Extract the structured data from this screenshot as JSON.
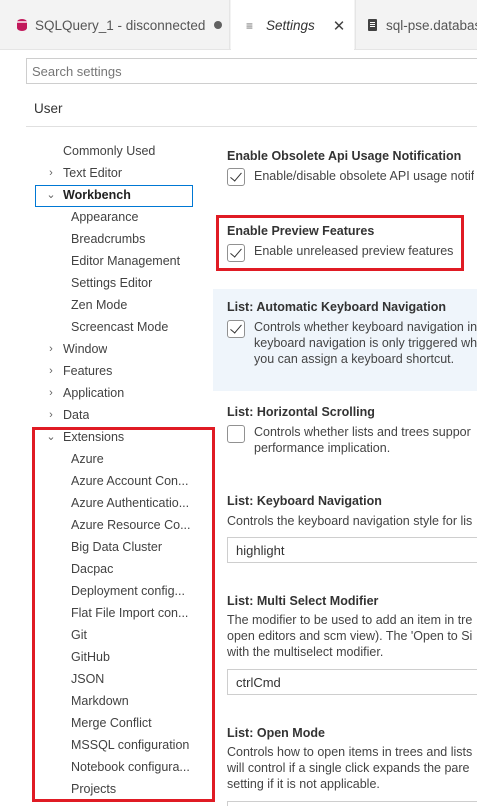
{
  "tabs": [
    {
      "label": "SQLQuery_1 - disconnected",
      "icon": "database-icon"
    },
    {
      "label": "Settings",
      "icon": "settings-icon",
      "close": "✕"
    },
    {
      "label": "sql-pse.databas",
      "icon": "file-icon"
    }
  ],
  "search": {
    "placeholder": "Search settings"
  },
  "scope": {
    "user": "User"
  },
  "toc": {
    "commonly_used": "Commonly Used",
    "text_editor": "Text Editor",
    "workbench": "Workbench",
    "appearance": "Appearance",
    "breadcrumbs": "Breadcrumbs",
    "editor_management": "Editor Management",
    "settings_editor": "Settings Editor",
    "zen_mode": "Zen Mode",
    "screencast_mode": "Screencast Mode",
    "window": "Window",
    "features": "Features",
    "application": "Application",
    "data": "Data",
    "extensions": "Extensions",
    "ext_items": [
      "Azure",
      "Azure Account Con...",
      "Azure Authenticatio...",
      "Azure Resource Co...",
      "Big Data Cluster",
      "Dacpac",
      "Deployment config...",
      "Flat File Import con...",
      "Git",
      "GitHub",
      "JSON",
      "Markdown",
      "Merge Conflict",
      "MSSQL configuration",
      "Notebook configura...",
      "Projects"
    ]
  },
  "settings": {
    "obsolete": {
      "title": "Enable Obsolete Api Usage Notification",
      "desc": "Enable/disable obsolete API usage notif"
    },
    "preview": {
      "title": "Enable Preview Features",
      "desc": "Enable unreleased preview features"
    },
    "auto_kbd": {
      "cat": "List: ",
      "title": "Automatic Keyboard Navigation",
      "desc1": "Controls whether keyboard navigation in",
      "desc2": "keyboard navigation is only triggered wh",
      "desc3": "you can assign a keyboard shortcut."
    },
    "hscroll": {
      "cat": "List: ",
      "title": "Horizontal Scrolling",
      "desc1": "Controls whether lists and trees suppor",
      "desc2": "performance implication."
    },
    "kbd_nav": {
      "cat": "List: ",
      "title": "Keyboard Navigation",
      "desc": "Controls the keyboard navigation style for lis",
      "value": "highlight"
    },
    "multi": {
      "cat": "List: ",
      "title": "Multi Select Modifier",
      "desc1": "The modifier to be used to add an item in tre",
      "desc2": "open editors and scm view). The 'Open to Si",
      "desc3": "with the multiselect modifier.",
      "value": "ctrlCmd"
    },
    "open_mode": {
      "cat": "List: ",
      "title": "Open Mode",
      "desc1": "Controls how to open items in trees and lists",
      "desc2": "will control if a single click expands the pare",
      "desc3": "setting if it is not applicable."
    }
  },
  "colors": {
    "highlight_red": "#e01b24",
    "focus_blue": "#0078d4"
  }
}
